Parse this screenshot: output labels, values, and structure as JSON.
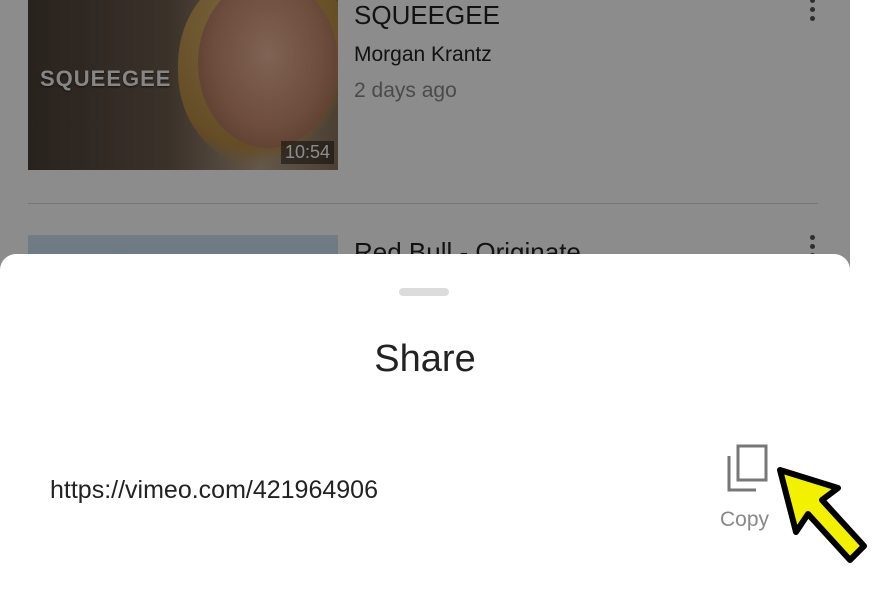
{
  "videos": [
    {
      "title": "SQUEEGEE",
      "author": "Morgan Krantz",
      "time": "2 days ago",
      "duration": "10:54",
      "thumb_text": "SQUEEGEE"
    },
    {
      "title": "Red Bull - Originate"
    }
  ],
  "share": {
    "title": "Share",
    "url": "https://vimeo.com/421964906",
    "copy_label": "Copy"
  },
  "colors": {
    "overlay": "#000000",
    "arrow": "#f2f200"
  },
  "icons": {
    "copy": "copy-icon",
    "more": "more-vertical-icon",
    "pointer": "pointer-arrow-icon"
  }
}
